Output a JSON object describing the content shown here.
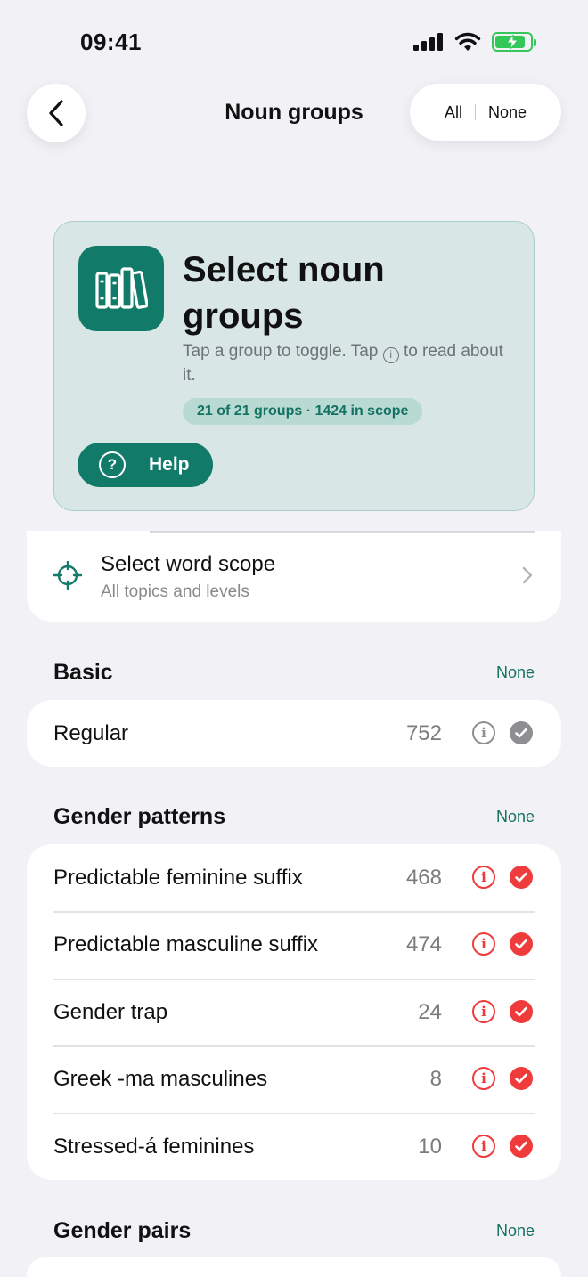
{
  "status_bar": {
    "time": "09:41"
  },
  "nav": {
    "title": "Noun groups",
    "all_label": "All",
    "none_label": "None"
  },
  "hero": {
    "title": "Select noun groups",
    "subtitle_before": "Tap a group to toggle. Tap",
    "subtitle_info_glyph": "i",
    "subtitle_after": "to read about it.",
    "badge": "21 of 21 groups · 1424 in scope",
    "help_label": "Help",
    "help_glyph": "?"
  },
  "scope": {
    "title": "Select word scope",
    "subtitle": "All topics and levels"
  },
  "sections": {
    "basic": {
      "title": "Basic",
      "action": "None",
      "rows": [
        {
          "label": "Regular",
          "count": "752"
        }
      ]
    },
    "gender_patterns": {
      "title": "Gender patterns",
      "action": "None",
      "rows": [
        {
          "label": "Predictable feminine suffix",
          "count": "468"
        },
        {
          "label": "Predictable masculine suffix",
          "count": "474"
        },
        {
          "label": "Gender trap",
          "count": "24"
        },
        {
          "label": "Greek -ma masculines",
          "count": "8"
        },
        {
          "label": "Stressed-á feminines",
          "count": "10"
        }
      ]
    },
    "gender_pairs": {
      "title": "Gender pairs",
      "action": "None"
    }
  },
  "info_glyph": "i",
  "colors": {
    "accent": "#117a68",
    "accent_text": "#137262",
    "selected_red": "#ef3b3b",
    "neutral_grey": "#8e8e93",
    "hero_bg": "#d9e6e6",
    "page_bg": "#f2f2f6"
  },
  "icons": {
    "back": "chevron-left-icon",
    "signal": "cellular-signal-icon",
    "wifi": "wifi-icon",
    "battery": "battery-charging-icon",
    "hero": "books-icon",
    "help": "question-circle-icon",
    "scope": "crosshair-icon",
    "scope_chevron": "chevron-right-icon",
    "info": "info-circle-icon",
    "check": "checkmark-circle-icon"
  }
}
